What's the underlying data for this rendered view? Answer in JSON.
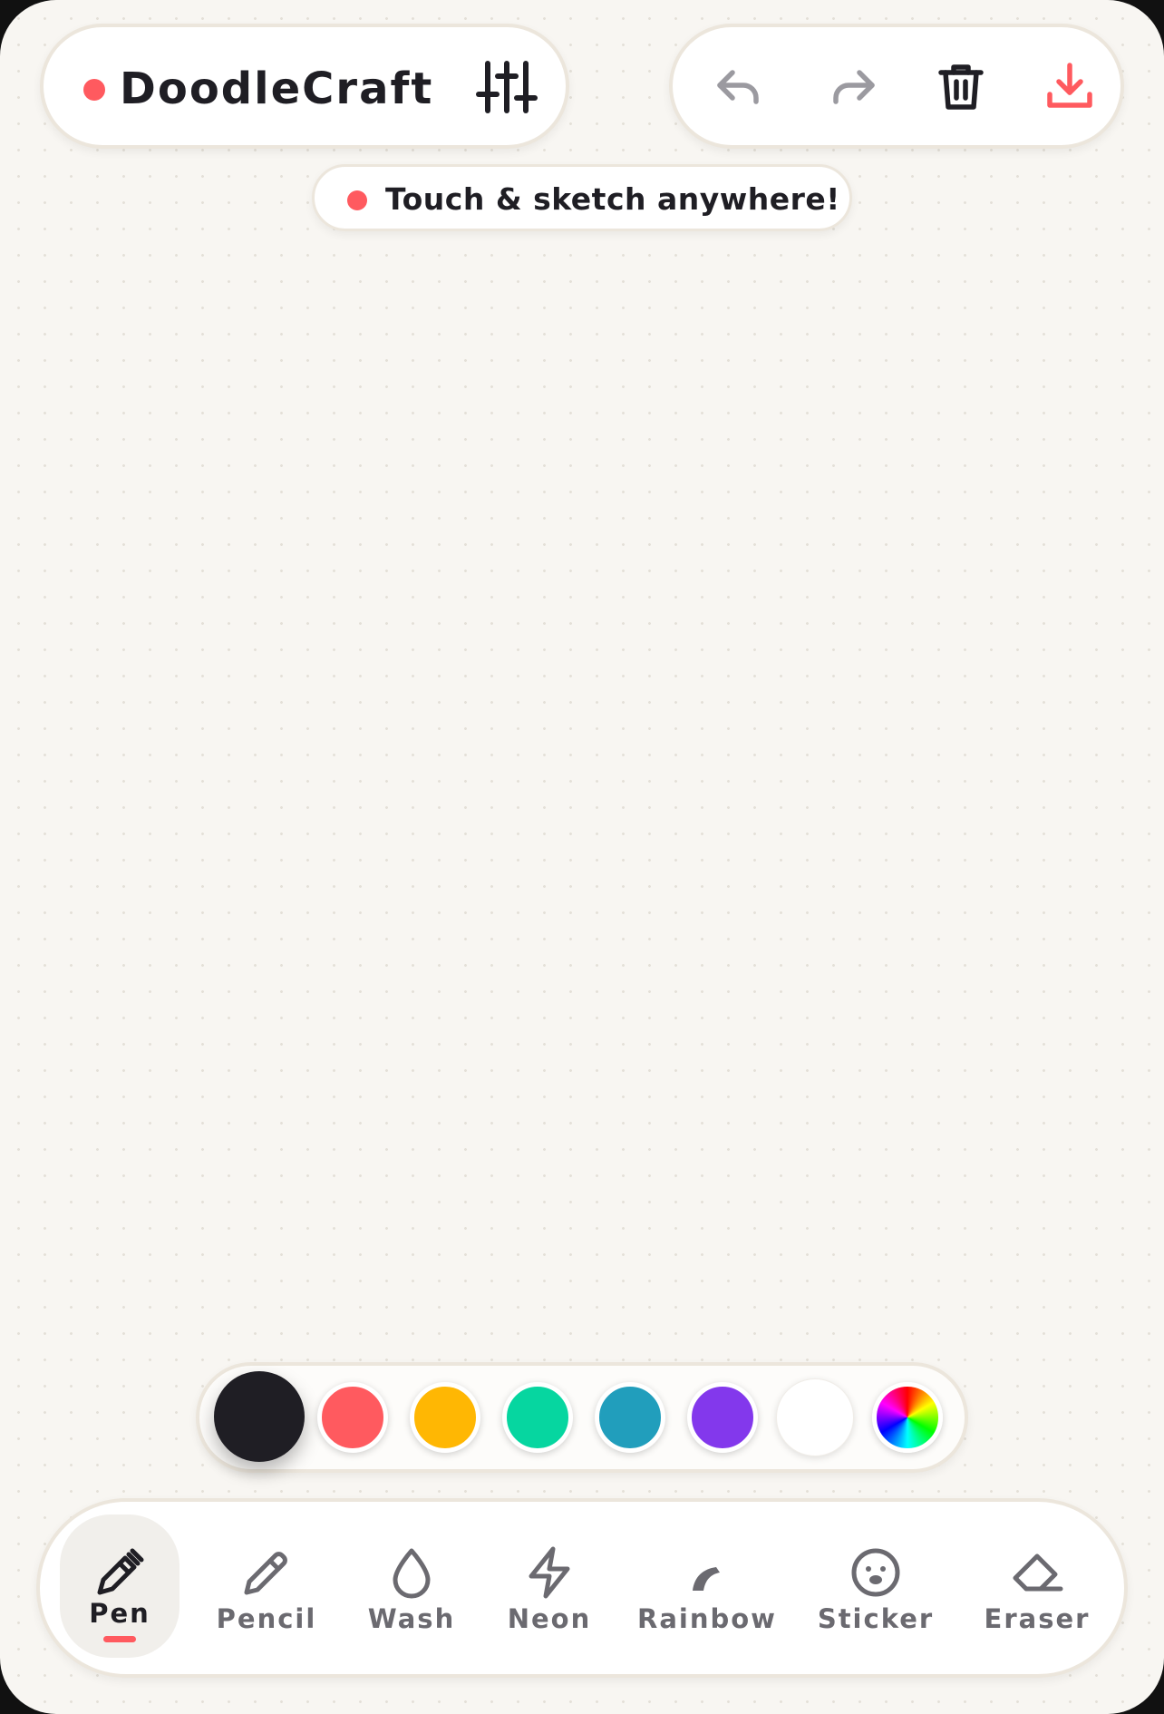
{
  "app": {
    "title": "DoodleCraft",
    "status_color": "#ff5a5f"
  },
  "header": {
    "settings_icon": "sliders-icon",
    "actions": [
      {
        "name": "undo",
        "icon": "undo-icon",
        "enabled": false
      },
      {
        "name": "redo",
        "icon": "redo-icon",
        "enabled": false
      },
      {
        "name": "clear",
        "icon": "trash-icon",
        "enabled": true
      },
      {
        "name": "download",
        "icon": "download-icon",
        "enabled": true
      }
    ]
  },
  "hint": {
    "text": "Touch & sketch anywhere!"
  },
  "palette": {
    "selected": "#1f1e24",
    "colors": [
      "#1f1e24",
      "#ff5a5f",
      "#ffb703",
      "#06d6a0",
      "#219ebc",
      "#8338ec",
      "#ffffff"
    ],
    "custom_icon": "color-wheel-icon"
  },
  "tools": {
    "selected": "Pen",
    "items": [
      {
        "label": "Pen",
        "icon": "pen-icon"
      },
      {
        "label": "Pencil",
        "icon": "pencil-icon"
      },
      {
        "label": "Wash",
        "icon": "droplet-icon"
      },
      {
        "label": "Neon",
        "icon": "lightning-icon"
      },
      {
        "label": "Rainbow",
        "icon": "rainbow-icon"
      },
      {
        "label": "Sticker",
        "icon": "smiley-icon"
      },
      {
        "label": "Eraser",
        "icon": "eraser-icon"
      }
    ]
  }
}
